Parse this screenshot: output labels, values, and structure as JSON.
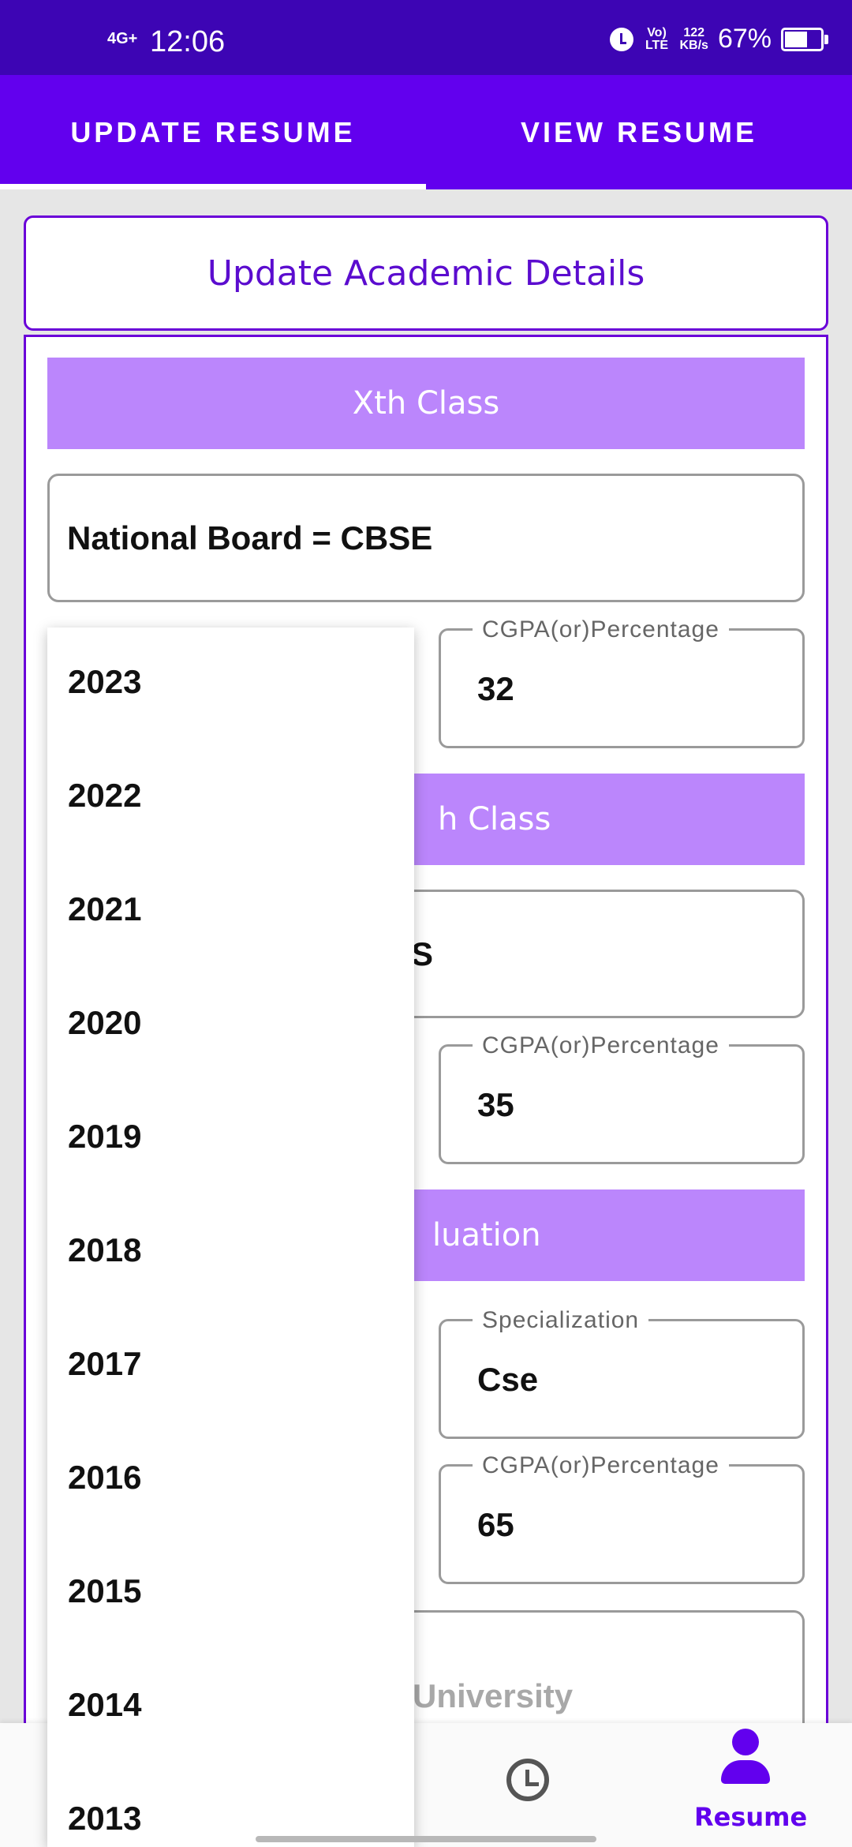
{
  "status_bar": {
    "network": "4G+",
    "time": "12:06",
    "volte": "Vo) LTE",
    "speed": "122",
    "speed_unit": "KB/s",
    "battery": "67%",
    "battery_level": 0.67
  },
  "tabs": [
    {
      "label": "UPDATE RESUME",
      "selected": true
    },
    {
      "label": "VIEW RESUME",
      "selected": false
    }
  ],
  "header": {
    "title": "Update Academic Details"
  },
  "sections": {
    "xth": {
      "title": "Xth Class",
      "board": "National Board = CBSE",
      "cgpa_label": "CGPA(or)Percentage",
      "cgpa_value": "32"
    },
    "xiith": {
      "title_visible": "h Class",
      "board_visible": "S",
      "cgpa_label": "CGPA(or)Percentage",
      "cgpa_value": "35"
    },
    "graduation": {
      "title_visible": "luation",
      "specialization_label": "Specialization",
      "specialization_value": "Cse",
      "cgpa_label": "CGPA(or)Percentage",
      "cgpa_value": "65",
      "university_placeholder": "University"
    }
  },
  "dropdown": {
    "years": [
      "2023",
      "2022",
      "2021",
      "2020",
      "2019",
      "2018",
      "2017",
      "2016",
      "2015",
      "2014",
      "2013"
    ]
  },
  "bottom_nav": {
    "active_label": "Resume",
    "accent": "#6200ee"
  }
}
